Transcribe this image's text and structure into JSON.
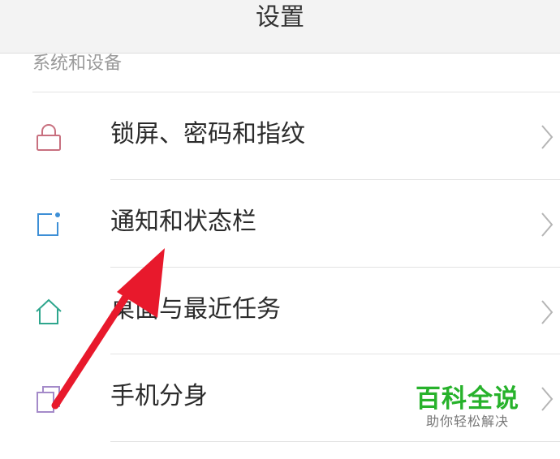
{
  "header": {
    "title": "设置"
  },
  "section": {
    "title": "系统和设备"
  },
  "rows": [
    {
      "label": "锁屏、密码和指纹",
      "icon": "lock-icon",
      "icon_color": "#c8707f"
    },
    {
      "label": "通知和状态栏",
      "icon": "notification-icon",
      "icon_color": "#3d8fd6"
    },
    {
      "label": "桌面与最近任务",
      "icon": "home-icon",
      "icon_color": "#2ea68d"
    },
    {
      "label": "手机分身",
      "icon": "clone-icon",
      "icon_color": "#a48ac9"
    }
  ],
  "watermark": {
    "title": "百科全说",
    "subtitle": "助你轻松解决"
  },
  "colors": {
    "annotation_arrow": "#e8192c",
    "watermark_green": "#27b22b",
    "chevron": "#b5b5b5"
  }
}
